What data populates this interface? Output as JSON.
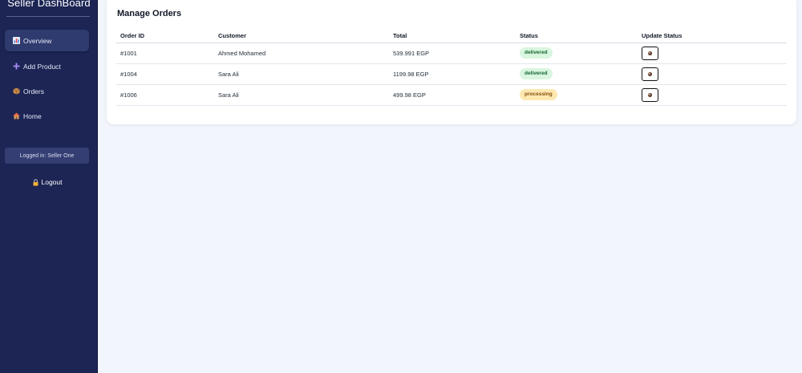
{
  "sidebar": {
    "brand": "Seller DashBoard",
    "items": [
      {
        "label": "Overview",
        "icon": "chart-icon",
        "active": true
      },
      {
        "label": "Add Product",
        "icon": "plus-icon",
        "active": false
      },
      {
        "label": "Orders",
        "icon": "box-icon",
        "active": false
      },
      {
        "label": "Home",
        "icon": "home-icon",
        "active": false
      }
    ],
    "logged_in": "Logged in: Seller One",
    "logout": "Logout"
  },
  "main": {
    "title": "Manage Orders",
    "columns": [
      "Order ID",
      "Customer",
      "Total",
      "Status",
      "Update Status"
    ],
    "rows": [
      {
        "id": "#1001",
        "customer": "Ahmed Mohamed",
        "total": "539.991 EGP",
        "status": "delivered"
      },
      {
        "id": "#1004",
        "customer": "Sara Ali",
        "total": "1199.98 EGP",
        "status": "delivered"
      },
      {
        "id": "#1006",
        "customer": "Sara Ali",
        "total": "499.98 EGP",
        "status": "processing"
      }
    ]
  },
  "colors": {
    "sidebar_bg": "#1c2554",
    "active_item": "#2f3a6e",
    "page_bg": "#f3f5fc",
    "delivered_bg": "#d9f6df",
    "processing_bg": "#fde8b0"
  }
}
